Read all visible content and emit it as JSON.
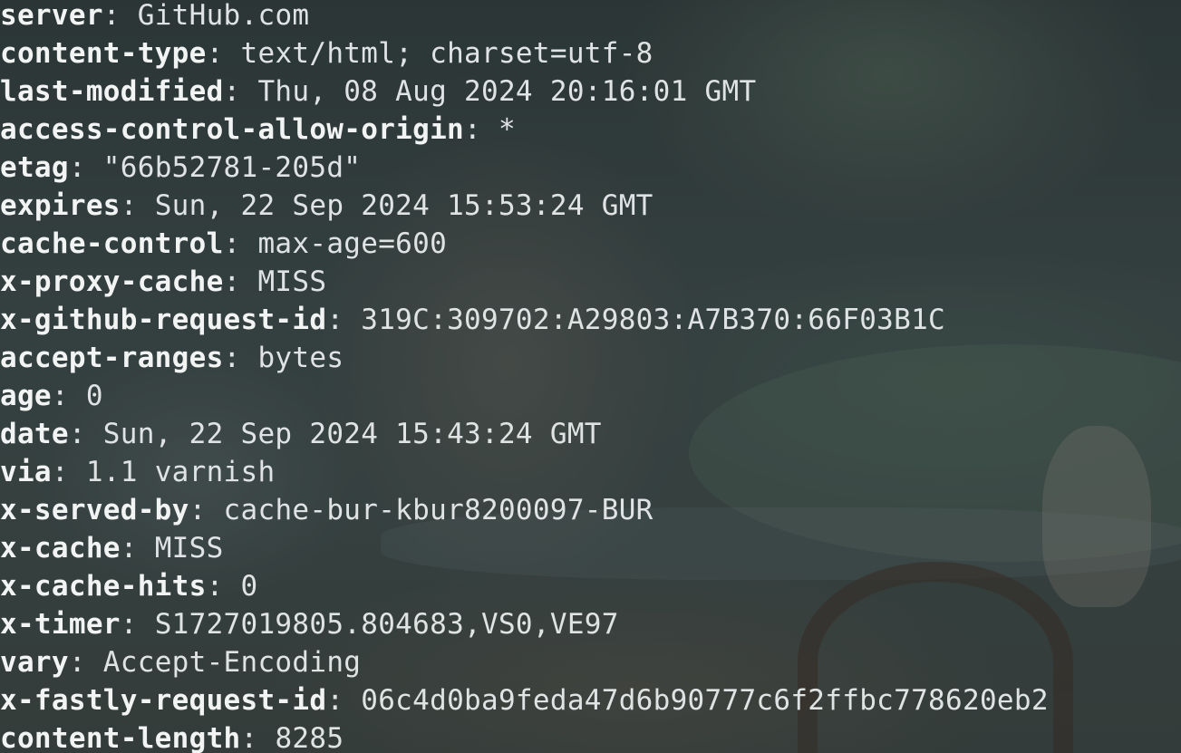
{
  "terminal": {
    "headers": [
      {
        "name": "server",
        "value": "GitHub.com"
      },
      {
        "name": "content-type",
        "value": "text/html; charset=utf-8"
      },
      {
        "name": "last-modified",
        "value": "Thu, 08 Aug 2024 20:16:01 GMT"
      },
      {
        "name": "access-control-allow-origin",
        "value": "*"
      },
      {
        "name": "etag",
        "value": "\"66b52781-205d\""
      },
      {
        "name": "expires",
        "value": "Sun, 22 Sep 2024 15:53:24 GMT"
      },
      {
        "name": "cache-control",
        "value": "max-age=600"
      },
      {
        "name": "x-proxy-cache",
        "value": "MISS"
      },
      {
        "name": "x-github-request-id",
        "value": "319C:309702:A29803:A7B370:66F03B1C"
      },
      {
        "name": "accept-ranges",
        "value": "bytes"
      },
      {
        "name": "age",
        "value": "0"
      },
      {
        "name": "date",
        "value": "Sun, 22 Sep 2024 15:43:24 GMT"
      },
      {
        "name": "via",
        "value": "1.1 varnish"
      },
      {
        "name": "x-served-by",
        "value": "cache-bur-kbur8200097-BUR"
      },
      {
        "name": "x-cache",
        "value": "MISS"
      },
      {
        "name": "x-cache-hits",
        "value": "0"
      },
      {
        "name": "x-timer",
        "value": "S1727019805.804683,VS0,VE97"
      },
      {
        "name": "vary",
        "value": "Accept-Encoding"
      },
      {
        "name": "x-fastly-request-id",
        "value": "06c4d0ba9feda47d6b90777c6f2ffbc778620eb2"
      },
      {
        "name": "content-length",
        "value": "8285"
      }
    ],
    "separator": ": "
  },
  "colors": {
    "header_name": "#f2f4f4",
    "header_value": "#dfe3e3",
    "background": "#3a4646"
  }
}
